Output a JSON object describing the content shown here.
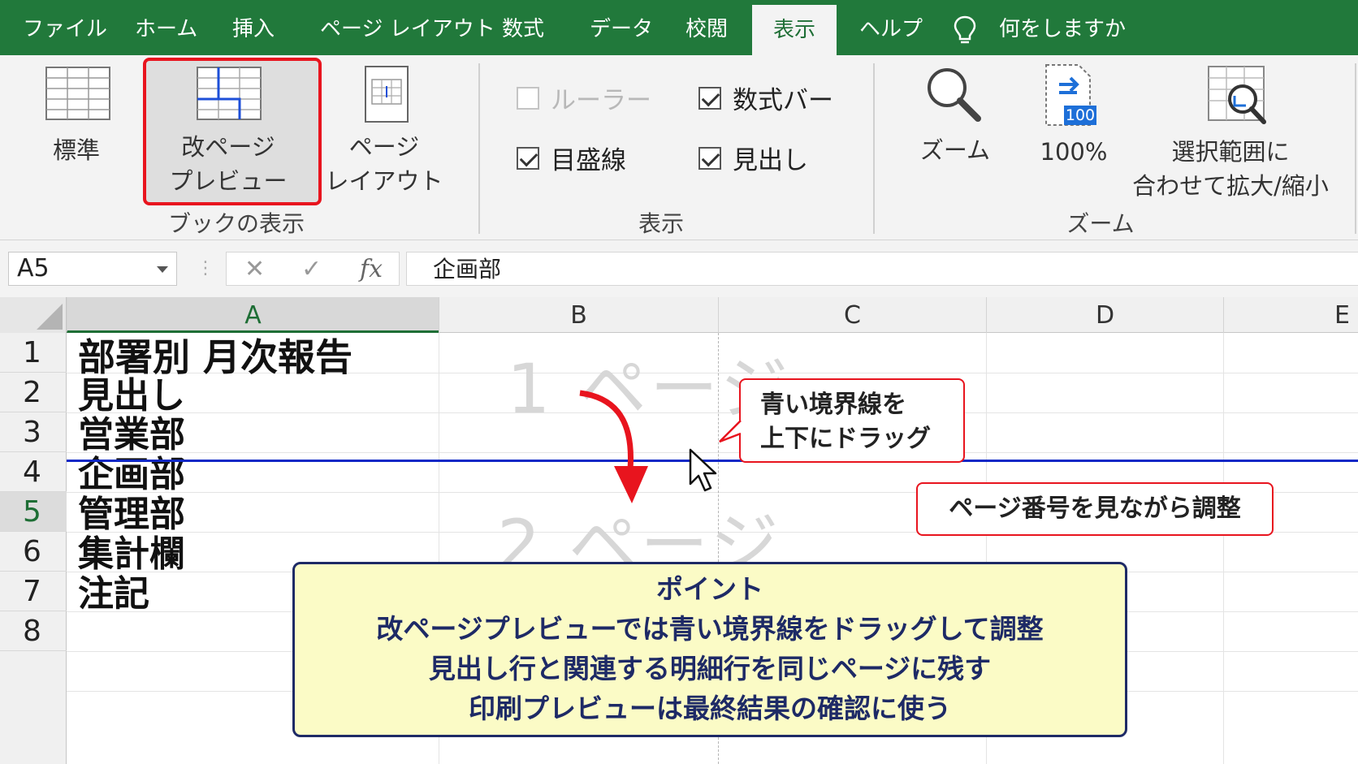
{
  "menu": {
    "tabs": [
      {
        "label": "ファイル"
      },
      {
        "label": "ホーム"
      },
      {
        "label": "挿入"
      },
      {
        "label": "ページ レイアウト"
      },
      {
        "label": "数式"
      },
      {
        "label": "データ"
      },
      {
        "label": "校閲"
      },
      {
        "label": "表示",
        "active": true
      },
      {
        "label": "ヘルプ"
      }
    ],
    "tell_me": "何をしますか"
  },
  "ribbon": {
    "book_view": {
      "group_label": "ブックの表示",
      "normal": "標準",
      "page_break_line1": "改ページ",
      "page_break_line2": "プレビュー",
      "page_layout_line1": "ページ",
      "page_layout_line2": "レイアウト"
    },
    "show": {
      "group_label": "表示",
      "ruler": {
        "label": "ルーラー",
        "checked": false,
        "enabled": false
      },
      "formula_bar": {
        "label": "数式バー",
        "checked": true
      },
      "gridlines": {
        "label": "目盛線",
        "checked": true
      },
      "headings": {
        "label": "見出し",
        "checked": true
      }
    },
    "zoom": {
      "group_label": "ズーム",
      "zoom": "ズーム",
      "zoom100": "100%",
      "zoom100_badge": "100",
      "fit_line1": "選択範囲に",
      "fit_line2": "合わせて拡大/縮小"
    }
  },
  "formula_bar": {
    "name_box": "A5",
    "cancel": "✕",
    "enter": "✓",
    "fx": "fx",
    "value": "企画部"
  },
  "sheet": {
    "columns": [
      "A",
      "B",
      "C",
      "D",
      "E"
    ],
    "selected_column": "A",
    "rows": [
      "1",
      "2",
      "3",
      "4",
      "5",
      "6",
      "7",
      "8"
    ],
    "selected_row": "5",
    "cells": {
      "A1": "部署別 月次報告",
      "A2": "見出し",
      "A3": "営業部",
      "A4": "企画部",
      "A5": "管理部",
      "A6": "集計欄",
      "A7": "注記"
    },
    "page1_watermark": "1 ページ",
    "page2_watermark": "2 ページ",
    "break_line_color": "#0f28c6"
  },
  "annotations": {
    "drag_callout_line1": "青い境界線を",
    "drag_callout_line2": "上下にドラッグ",
    "page_number_callout": "ページ番号を見ながら調整",
    "point_title": "ポイント",
    "point_line1": "改ページプレビューでは青い境界線をドラッグして調整",
    "point_line2": "見出し行と関連する明細行を同じページに残す",
    "point_line3": "印刷プレビューは最終結果の確認に使う",
    "accent_color": "#e8141e"
  }
}
